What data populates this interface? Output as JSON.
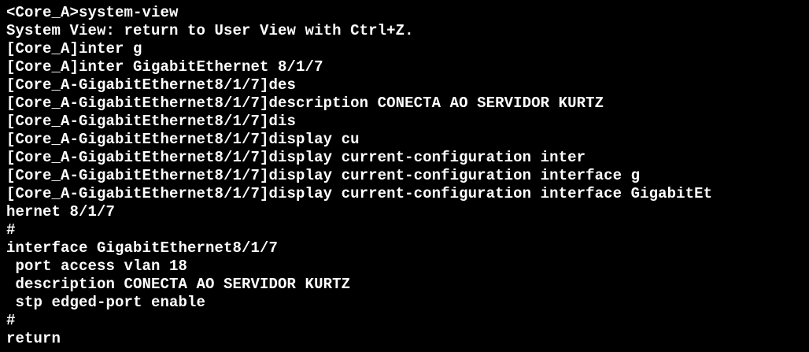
{
  "terminal": {
    "lines": [
      "<Core_A>system-view",
      "System View: return to User View with Ctrl+Z.",
      "[Core_A]inter g",
      "[Core_A]inter GigabitEthernet 8/1/7",
      "[Core_A-GigabitEthernet8/1/7]des",
      "[Core_A-GigabitEthernet8/1/7]description CONECTA AO SERVIDOR KURTZ",
      "[Core_A-GigabitEthernet8/1/7]dis",
      "[Core_A-GigabitEthernet8/1/7]display cu",
      "[Core_A-GigabitEthernet8/1/7]display current-configuration inter",
      "[Core_A-GigabitEthernet8/1/7]display current-configuration interface g",
      "[Core_A-GigabitEthernet8/1/7]display current-configuration interface GigabitEt",
      "hernet 8/1/7",
      "#",
      "interface GigabitEthernet8/1/7",
      " port access vlan 18",
      " description CONECTA AO SERVIDOR KURTZ",
      " stp edged-port enable",
      "#",
      "return"
    ]
  },
  "colors": {
    "background": "#000000",
    "text": "#ffffff"
  }
}
